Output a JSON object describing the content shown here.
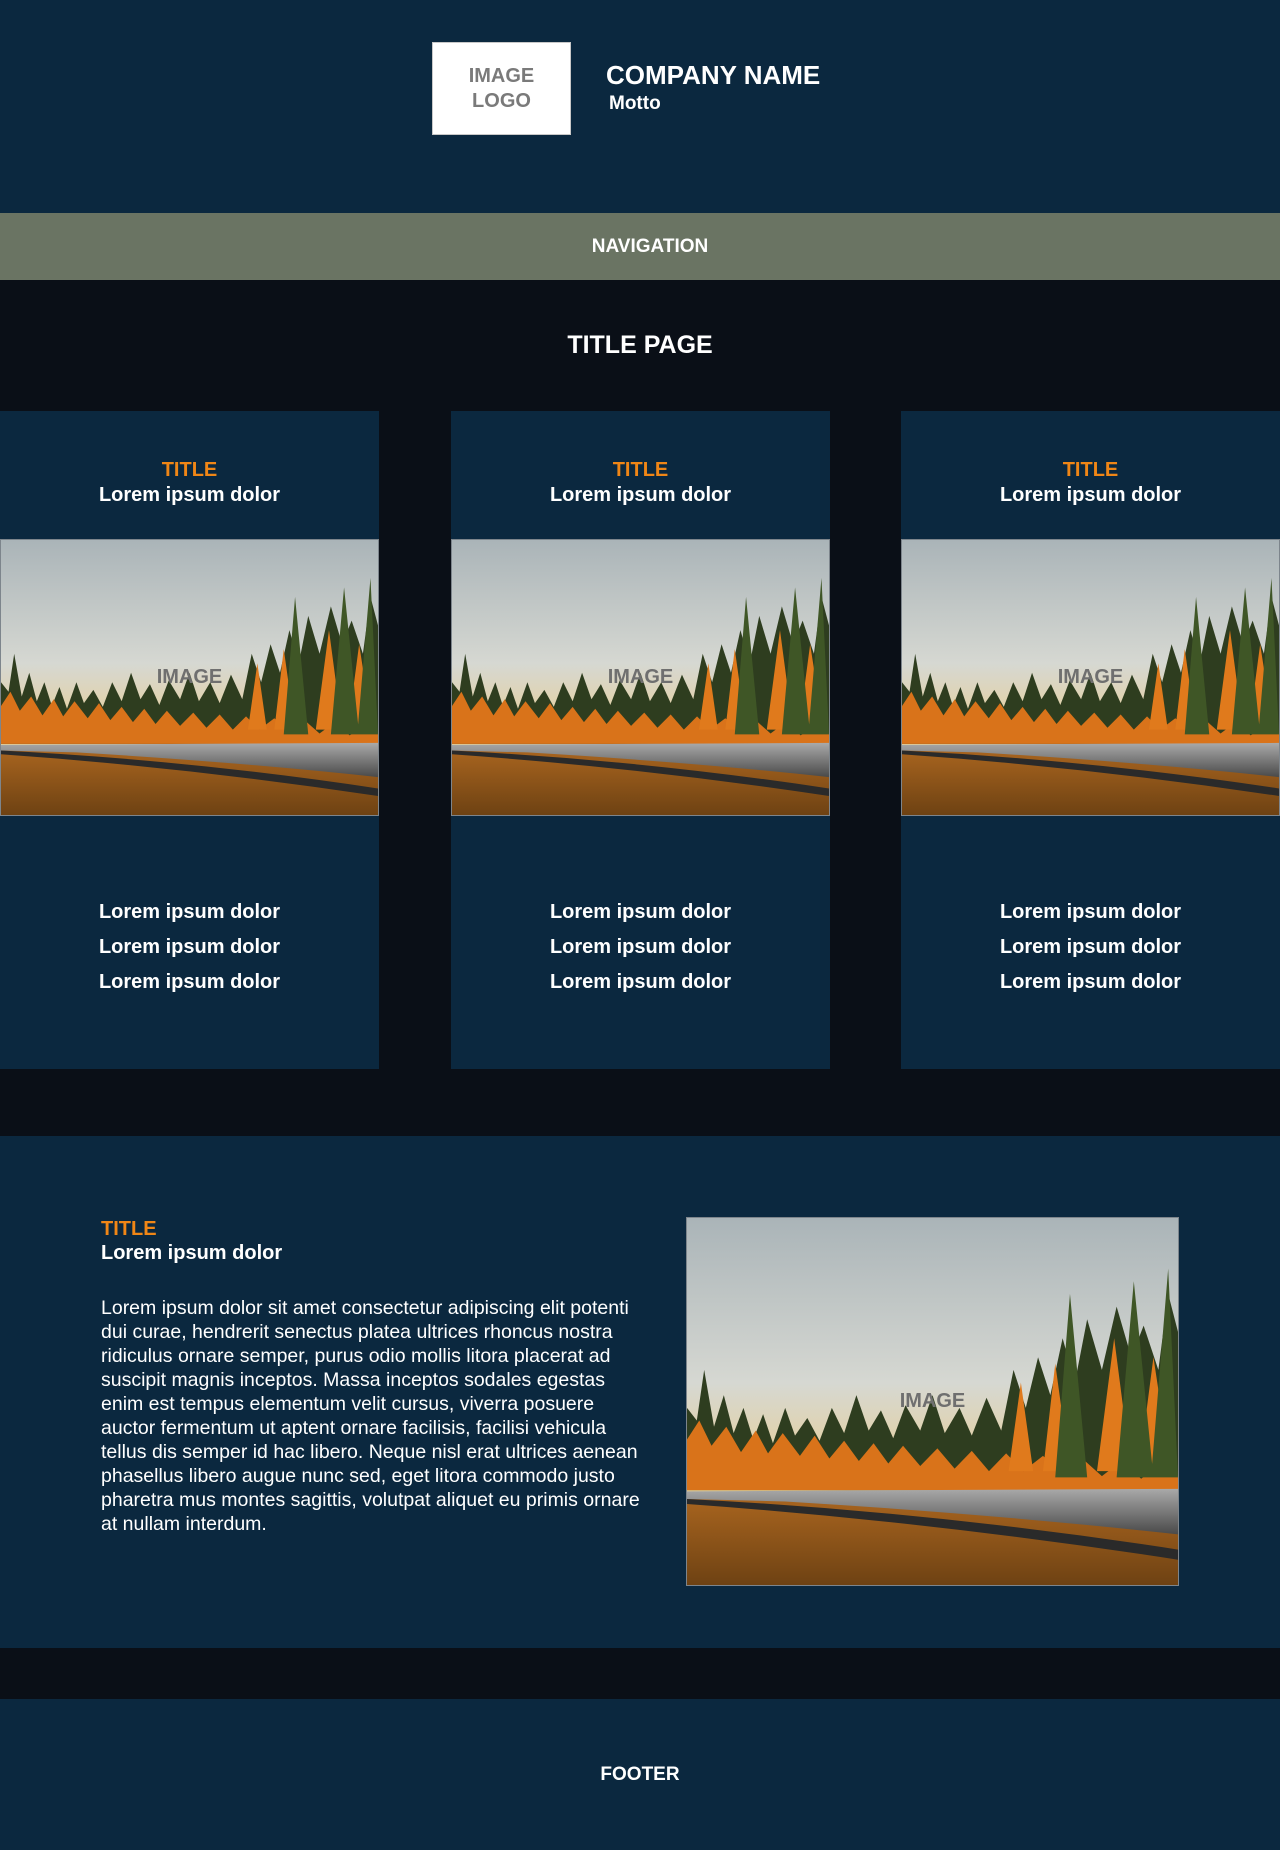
{
  "header": {
    "logo_text": "IMAGE LOGO",
    "company_name": "COMPANY NAME",
    "motto": "Motto"
  },
  "navigation": {
    "label": "NAVIGATION"
  },
  "page": {
    "title": "TITLE PAGE"
  },
  "cards": [
    {
      "title": "TITLE",
      "subtitle": "Lorem ipsum dolor",
      "image_label": "IMAGE",
      "lines": [
        "Lorem ipsum dolor",
        "Lorem ipsum dolor",
        "Lorem ipsum dolor"
      ]
    },
    {
      "title": "TITLE",
      "subtitle": "Lorem ipsum dolor",
      "image_label": "IMAGE",
      "lines": [
        "Lorem ipsum dolor",
        "Lorem ipsum dolor",
        "Lorem ipsum dolor"
      ]
    },
    {
      "title": "TITLE",
      "subtitle": "Lorem ipsum dolor",
      "image_label": "IMAGE",
      "lines": [
        "Lorem ipsum dolor",
        "Lorem ipsum dolor",
        "Lorem ipsum dolor"
      ]
    }
  ],
  "feature": {
    "title": "TITLE",
    "subtitle": "Lorem ipsum dolor",
    "body": "Lorem ipsum dolor sit amet consectetur adipiscing elit potenti dui curae, hendrerit senectus platea ultrices rhoncus nostra ridiculus ornare semper, purus odio mollis litora placerat ad suscipit magnis inceptos. Massa inceptos sodales egestas enim est tempus elementum velit cursus, viverra posuere auctor fermentum ut aptent ornare facilisis, facilisi vehicula tellus dis semper id hac libero. Neque nisl erat ultrices aenean phasellus libero augue nunc sed, eget litora commodo justo pharetra mus montes sagittis, volutpat aliquet eu primis ornare at nullam interdum.",
    "image_label": "IMAGE"
  },
  "footer": {
    "label": "FOOTER"
  },
  "colors": {
    "header_bg": "#0b283f",
    "page_bg": "#0a0f17",
    "nav_bg": "#6a7463",
    "accent": "#f08616"
  }
}
